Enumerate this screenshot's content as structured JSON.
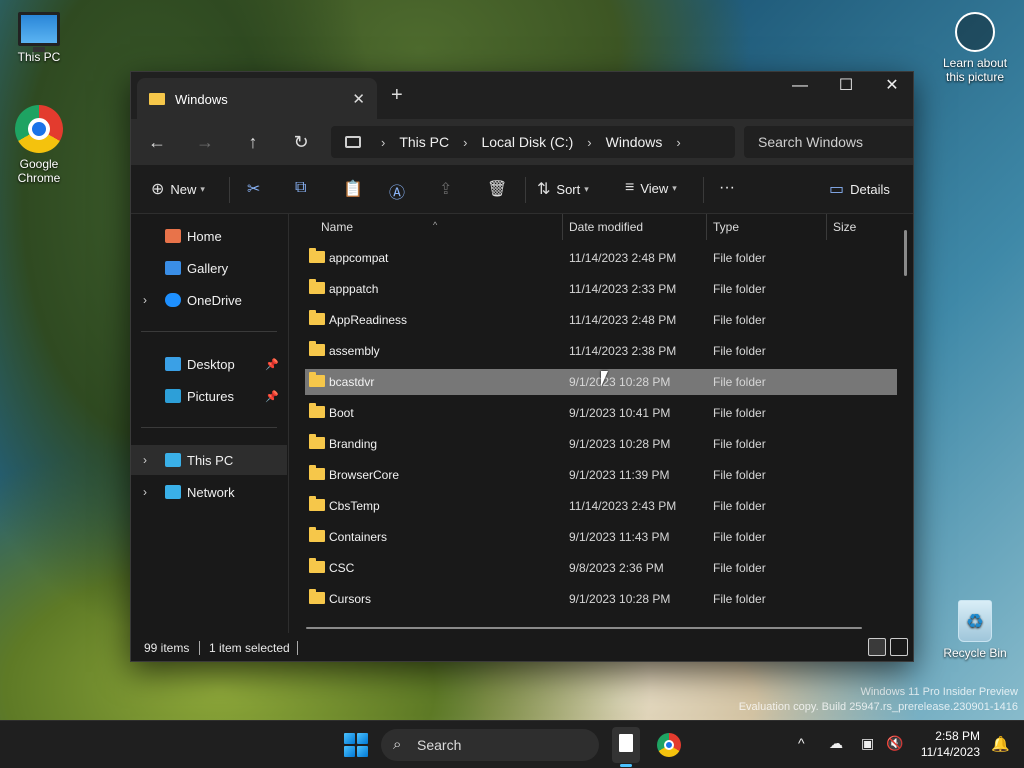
{
  "desktop": {
    "icons": [
      {
        "label": "This PC",
        "icon": "monitor-icon"
      },
      {
        "label": "Google Chrome",
        "icon": "chrome-icon"
      },
      {
        "label": "Learn about this picture",
        "icon": "learn-icon"
      },
      {
        "label": "Recycle Bin",
        "icon": "recycle-bin-icon"
      }
    ],
    "watermark_line1": "Windows 11 Pro Insider Preview",
    "watermark_line2": "Evaluation copy. Build 25947.rs_prerelease.230901-1416"
  },
  "explorer": {
    "tab_title": "Windows",
    "new_tab_symbol": "+",
    "breadcrumbs": [
      "This PC",
      "Local Disk (C:)",
      "Windows"
    ],
    "search_placeholder": "Search Windows",
    "toolbar": {
      "new_label": "New",
      "sort_label": "Sort",
      "view_label": "View",
      "more_label": "···",
      "details_label": "Details"
    },
    "nav": {
      "home": "Home",
      "gallery": "Gallery",
      "onedrive": "OneDrive",
      "desktop": "Desktop",
      "pictures": "Pictures",
      "thispc": "This PC",
      "network": "Network"
    },
    "columns": {
      "name": "Name",
      "date": "Date modified",
      "type": "Type",
      "size": "Size"
    },
    "files": [
      {
        "name": "appcompat",
        "date": "11/14/2023 2:48 PM",
        "type": "File folder"
      },
      {
        "name": "apppatch",
        "date": "11/14/2023 2:33 PM",
        "type": "File folder"
      },
      {
        "name": "AppReadiness",
        "date": "11/14/2023 2:48 PM",
        "type": "File folder"
      },
      {
        "name": "assembly",
        "date": "11/14/2023 2:38 PM",
        "type": "File folder"
      },
      {
        "name": "bcastdvr",
        "date": "9/1/2023 10:28 PM",
        "type": "File folder",
        "selected": true
      },
      {
        "name": "Boot",
        "date": "9/1/2023 10:41 PM",
        "type": "File folder"
      },
      {
        "name": "Branding",
        "date": "9/1/2023 10:28 PM",
        "type": "File folder"
      },
      {
        "name": "BrowserCore",
        "date": "9/1/2023 11:39 PM",
        "type": "File folder"
      },
      {
        "name": "CbsTemp",
        "date": "11/14/2023 2:43 PM",
        "type": "File folder"
      },
      {
        "name": "Containers",
        "date": "9/1/2023 11:43 PM",
        "type": "File folder"
      },
      {
        "name": "CSC",
        "date": "9/8/2023 2:36 PM",
        "type": "File folder"
      },
      {
        "name": "Cursors",
        "date": "9/1/2023 10:28 PM",
        "type": "File folder"
      }
    ],
    "status": {
      "items": "99 items",
      "selected": "1 item selected"
    }
  },
  "taskbar": {
    "search_label": "Search",
    "time": "2:58 PM",
    "date": "11/14/2023"
  }
}
